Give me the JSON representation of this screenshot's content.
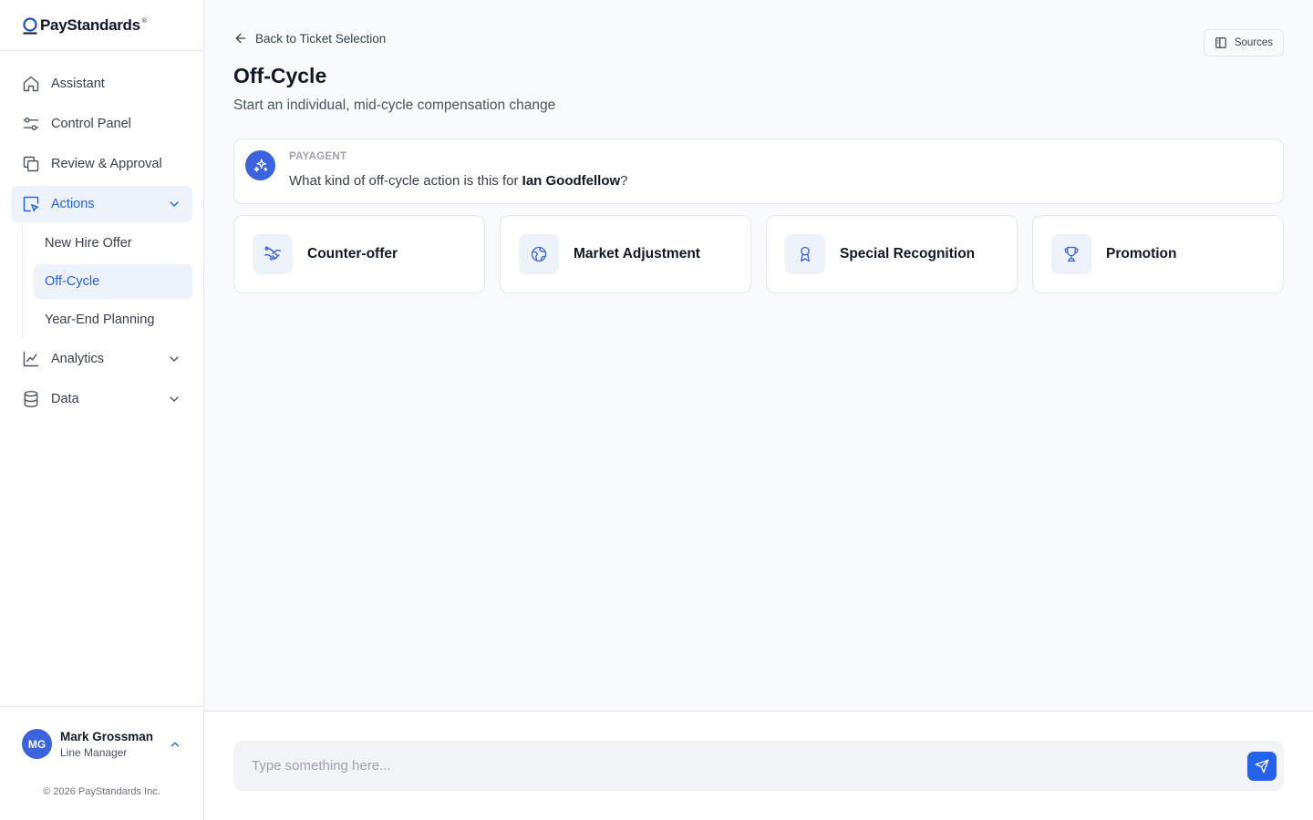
{
  "app": {
    "brand": "PayStandards",
    "brand_mark": "®"
  },
  "sidebar": {
    "items": [
      {
        "label": "Assistant",
        "icon": "home-icon"
      },
      {
        "label": "Control Panel",
        "icon": "sliders-icon"
      },
      {
        "label": "Review & Approval",
        "icon": "copy-icon"
      },
      {
        "label": "Actions",
        "icon": "cursor-click-icon",
        "expanded": true
      },
      {
        "label": "Analytics",
        "icon": "line-chart-icon"
      },
      {
        "label": "Data",
        "icon": "database-icon"
      }
    ],
    "actions_sub": [
      {
        "label": "New Hire Offer"
      },
      {
        "label": "Off-Cycle",
        "active": true
      },
      {
        "label": "Year-End Planning"
      }
    ]
  },
  "user": {
    "initials": "MG",
    "name": "Mark Grossman",
    "role": "Line Manager"
  },
  "footer": {
    "copyright": "© 2026 PayStandards Inc."
  },
  "header": {
    "back_label": "Back to Ticket Selection",
    "sources_label": "Sources",
    "title": "Off-Cycle",
    "subtitle": "Start an individual, mid-cycle compensation change"
  },
  "agent": {
    "name": "PAYAGENT",
    "message_prefix": "What kind of off-cycle action is this for ",
    "employee": "Ian Goodfellow",
    "message_suffix": "?"
  },
  "options": [
    {
      "label": "Counter-offer",
      "icon": "handshake-icon"
    },
    {
      "label": "Market Adjustment",
      "icon": "globe-icon"
    },
    {
      "label": "Special Recognition",
      "icon": "award-icon"
    },
    {
      "label": "Promotion",
      "icon": "trophy-icon"
    }
  ],
  "composer": {
    "placeholder": "Type something here..."
  },
  "colors": {
    "accent": "#2563eb",
    "accent_soft": "#eef2fb",
    "avatar": "#3b63e0"
  }
}
